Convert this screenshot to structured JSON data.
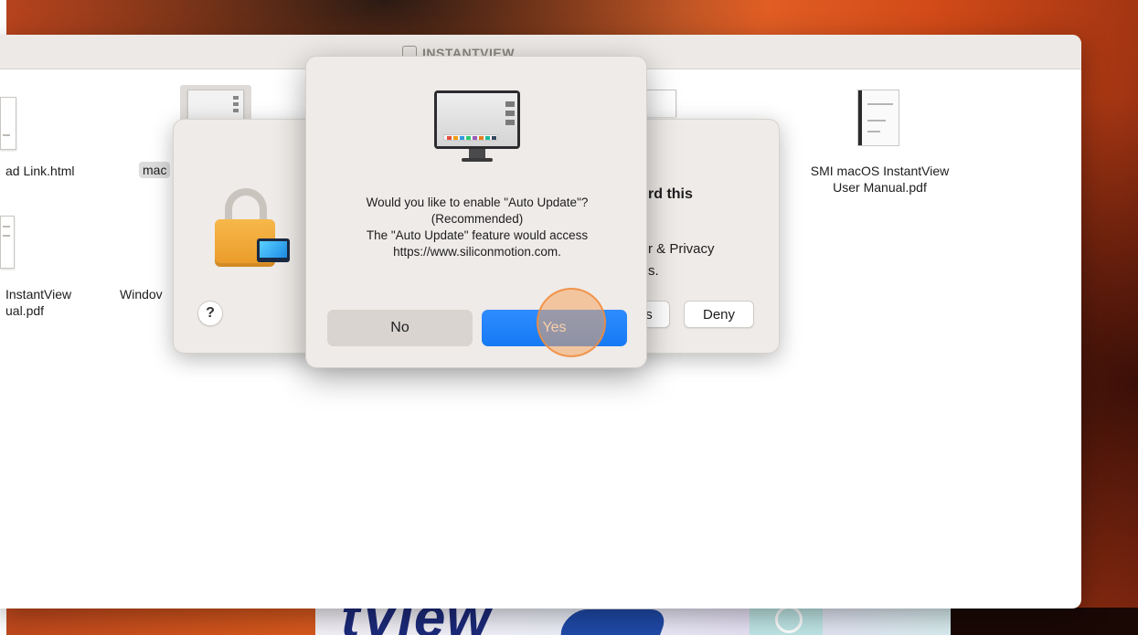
{
  "finder": {
    "title": "INSTANTVIEW",
    "files": [
      {
        "label": "ad Link.html"
      },
      {
        "label": "mac"
      },
      {
        "label": "SMI macOS InstantView",
        "label2": "User Manual.pdf"
      },
      {
        "label": "InstantView",
        "label2": "ual.pdf"
      },
      {
        "label": "Windov"
      }
    ]
  },
  "security_dialog": {
    "heading_fragment": "rd this",
    "text_line1": "r & Privacy",
    "text_line2": "s.",
    "help_label": "?",
    "btn_partial_label": "s",
    "deny_label": "Deny"
  },
  "alert": {
    "icon": "instantview-monitor-icon",
    "message_line1": "Would you like to enable \"Auto Update\"?",
    "message_line2": "(Recommended)",
    "message_line3": "The \"Auto Update\" feature would access",
    "message_line4": "https://www.siliconmotion.com.",
    "no_label": "No",
    "yes_label": "Yes"
  },
  "background": {
    "banner_text": "tView"
  },
  "colors": {
    "accent_blue": "#157af5",
    "click_marker": "#f4a662"
  }
}
